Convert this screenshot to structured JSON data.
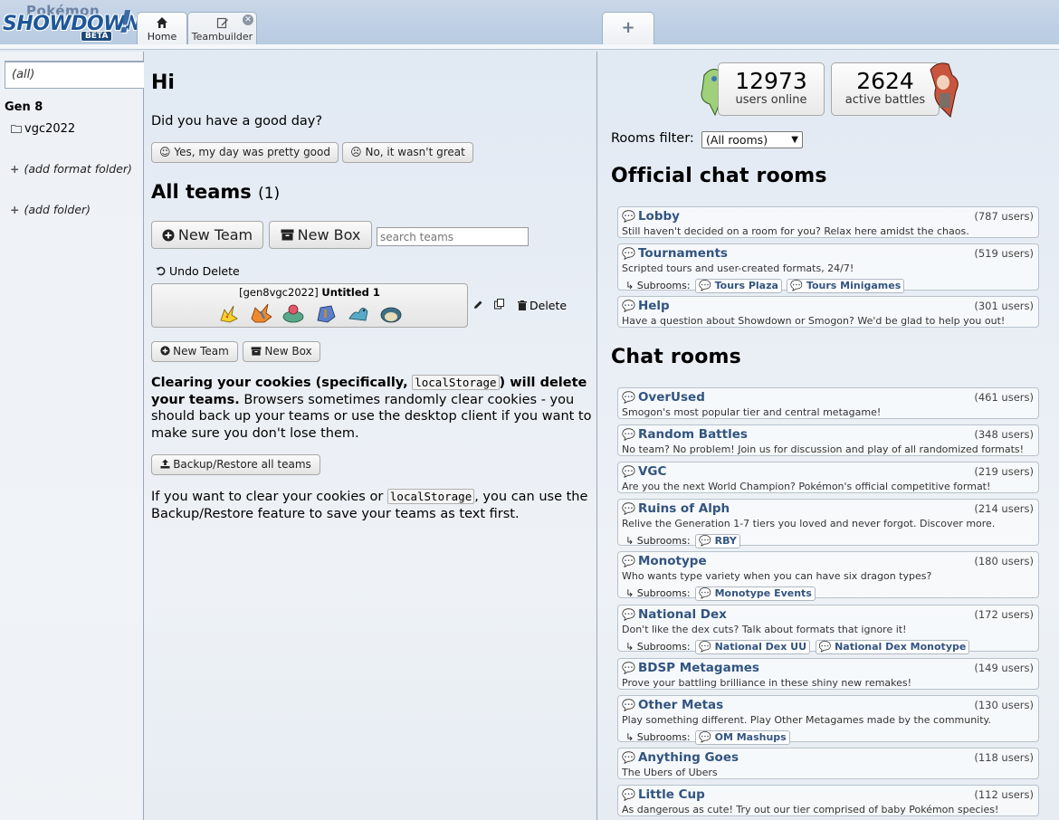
{
  "header": {
    "logo": {
      "pokemon": "Pokémon",
      "showdown": "SHOWDOWN",
      "beta": "BETA",
      "bang": "!"
    },
    "tabs": [
      {
        "label": "Home",
        "icon": "home-icon"
      },
      {
        "label": "Teambuilder",
        "icon": "edit-icon"
      }
    ],
    "new_tab": "+"
  },
  "sidebar": {
    "filter": "(all)",
    "gen": "Gen 8",
    "folders": [
      "vgc2022"
    ],
    "add_format_folder": "(add format folder)",
    "add_folder": "(add folder)"
  },
  "main": {
    "greeting": "Hi",
    "question": "Did you have a good day?",
    "yes_label": "☺ Yes, my day was pretty good",
    "no_label": "☹ No, it wasn't great",
    "all_teams": "All teams",
    "team_count": "(1)",
    "new_team": "New Team",
    "new_box": "New Box",
    "search_placeholder": "search teams",
    "undo_delete": "Undo Delete",
    "team": {
      "format": "[gen8vgc2022]",
      "name": "Untitled 1"
    },
    "delete": "Delete",
    "warn_bold_1": "Clearing your cookies (specifically,",
    "warn_code": "localStorage",
    "warn_bold_2": ") will delete your teams.",
    "warn_rest": " Browsers sometimes randomly clear cookies - you should back up your teams or use the desktop client if you want to make sure you don't lose them.",
    "backup": "Backup/Restore all teams",
    "note_1": "If you want to clear your cookies or",
    "note_code": "localStorage",
    "note_2": ", you can use the Backup/Restore feature to save your teams as text first."
  },
  "stats": {
    "users": "12973",
    "users_label": "users online",
    "battles": "2624",
    "battles_label": "active battles"
  },
  "rooms_filter": {
    "label": "Rooms filter:",
    "value": "(All rooms)"
  },
  "official_title": "Official chat rooms",
  "chat_title": "Chat rooms",
  "subrooms_label": "Subrooms:",
  "official_rooms": [
    {
      "name": "Lobby",
      "users": "(787 users)",
      "desc": "Still haven't decided on a room for you? Relax here amidst the chaos."
    },
    {
      "name": "Tournaments",
      "users": "(519 users)",
      "desc": "Scripted tours and user-created formats, 24/7!",
      "subs": [
        "Tours Plaza",
        "Tours Minigames"
      ]
    },
    {
      "name": "Help",
      "users": "(301 users)",
      "desc": "Have a question about Showdown or Smogon? We'd be glad to help you out!"
    }
  ],
  "chat_rooms": [
    {
      "name": "OverUsed",
      "users": "(461 users)",
      "desc": "Smogon's most popular tier and central metagame!"
    },
    {
      "name": "Random Battles",
      "users": "(348 users)",
      "desc": "No team? No problem! Join us for discussion and play of all randomized formats!"
    },
    {
      "name": "VGC",
      "users": "(219 users)",
      "desc": "Are you the next World Champion? Pokémon's official competitive format!"
    },
    {
      "name": "Ruins of Alph",
      "users": "(214 users)",
      "desc": "Relive the Generation 1-7 tiers you loved and never forgot. Discover more.",
      "subs": [
        "RBY"
      ]
    },
    {
      "name": "Monotype",
      "users": "(180 users)",
      "desc": "Who wants type variety when you can have six dragon types?",
      "subs": [
        "Monotype Events"
      ]
    },
    {
      "name": "National Dex",
      "users": "(172 users)",
      "desc": "Don't like the dex cuts? Talk about formats that ignore it!",
      "subs": [
        "National Dex UU",
        "National Dex Monotype"
      ]
    },
    {
      "name": "BDSP Metagames",
      "users": "(149 users)",
      "desc": "Prove your battling brilliance in these shiny new remakes!"
    },
    {
      "name": "Other Metas",
      "users": "(130 users)",
      "desc": "Play something different. Play Other Metagames made by the community.",
      "subs": [
        "OM Mashups"
      ]
    },
    {
      "name": "Anything Goes",
      "users": "(118 users)",
      "desc": "The Ubers of Ubers"
    },
    {
      "name": "Little Cup",
      "users": "(112 users)",
      "desc": "As dangerous as cute! Try out our tier comprised of baby Pokémon species!"
    }
  ],
  "colors": {
    "link": "#325480",
    "header": "#b8cbe2"
  }
}
